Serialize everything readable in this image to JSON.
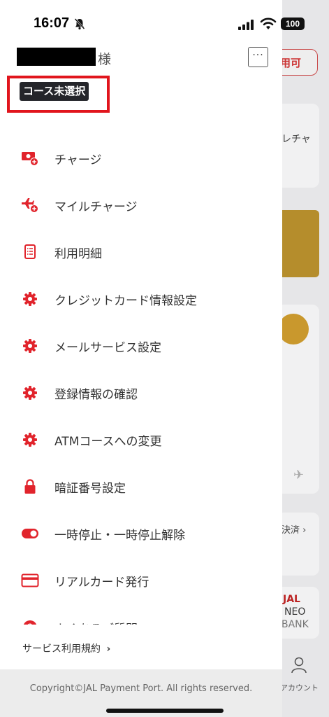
{
  "status_bar": {
    "time": "16:07",
    "battery": "100"
  },
  "header": {
    "honorific": "様",
    "more_label": "···"
  },
  "course_badge": "コース未選択",
  "menu": [
    {
      "label": "チャージ",
      "icon": "charge-icon"
    },
    {
      "label": "マイルチャージ",
      "icon": "mile-charge-icon"
    },
    {
      "label": "利用明細",
      "icon": "statement-icon"
    },
    {
      "label": "クレジットカード情報設定",
      "icon": "gear-icon"
    },
    {
      "label": "メールサービス設定",
      "icon": "gear-icon"
    },
    {
      "label": "登録情報の確認",
      "icon": "gear-icon"
    },
    {
      "label": "ATMコースへの変更",
      "icon": "gear-icon"
    },
    {
      "label": "暗証番号設定",
      "icon": "lock-icon"
    },
    {
      "label": "一時停止・一時停止解除",
      "icon": "toggle-icon"
    },
    {
      "label": "リアルカード発行",
      "icon": "card-icon"
    },
    {
      "label": "よくあるご質問",
      "icon": "question-icon"
    }
  ],
  "terms_link": "サービス利用規約",
  "terms_chevron": "›",
  "footer": "Copyright©JAL Payment Port. All rights reserved.",
  "background": {
    "chip": "利用可能",
    "card1_text": "レチャ",
    "card3_text": "決済 ›",
    "card4_a": "JAL",
    "card4_b": "NEO",
    "card4_c": "BANK",
    "tab_account": "アカウント"
  },
  "colors": {
    "accent": "#e1242c",
    "highlight": "#e1151d",
    "badge": "#24252a"
  }
}
